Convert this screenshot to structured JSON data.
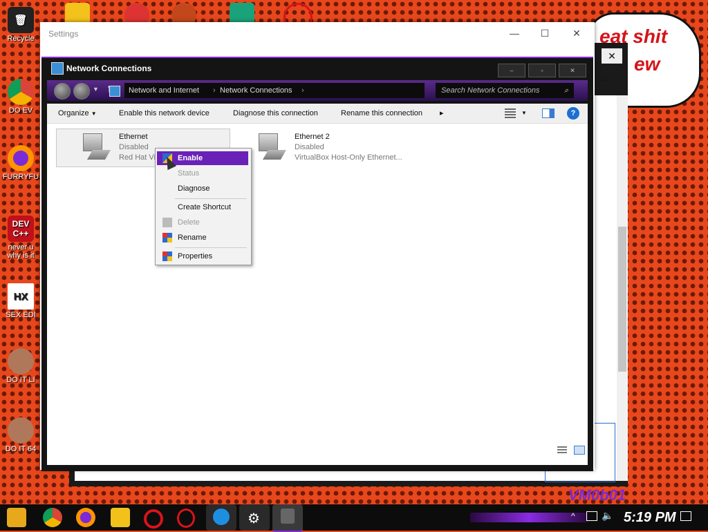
{
  "desktop": {
    "icons": [
      {
        "label": "Recycle"
      },
      {
        "label": "DO EV"
      },
      {
        "label": "FURRYFU"
      },
      {
        "label": "never u why is it"
      },
      {
        "label": "SEX EDI"
      },
      {
        "label": "DO IT LI"
      },
      {
        "label": "DO IT 64"
      }
    ],
    "bubble_text": [
      "eat shit",
      "ew"
    ],
    "watermark": "VM0b01"
  },
  "settings_window": {
    "title": "Settings",
    "minimize": "—",
    "maximize": "☐",
    "close": "✕"
  },
  "background_window": {
    "close": "✕",
    "more": "⋯"
  },
  "network_window": {
    "title": "Network Connections",
    "minimize": "–",
    "maximize": "▫",
    "close": "✕",
    "breadcrumb": [
      "Network and Internet",
      "Network Connections"
    ],
    "search_placeholder": "Search Network Connections",
    "toolbar": {
      "organize": "Organize",
      "enable": "Enable this network device",
      "diagnose": "Diagnose this connection",
      "rename": "Rename this connection"
    },
    "connections": [
      {
        "name": "Ethernet",
        "status": "Disabled",
        "adapter": "Red Hat Vir"
      },
      {
        "name": "Ethernet 2",
        "status": "Disabled",
        "adapter": "VirtualBox Host-Only Ethernet..."
      }
    ]
  },
  "context_menu": {
    "items": [
      {
        "label": "Enable",
        "state": "highlighted"
      },
      {
        "label": "Status",
        "state": "disabled"
      },
      {
        "label": "Diagnose",
        "state": "normal"
      },
      {
        "label": "Create Shortcut",
        "state": "normal"
      },
      {
        "label": "Delete",
        "state": "disabled"
      },
      {
        "label": "Rename",
        "state": "normal"
      },
      {
        "label": "Properties",
        "state": "normal"
      }
    ]
  },
  "taskbar": {
    "time": "5:19 PM",
    "pinned": [
      "start-icon",
      "chrome-icon",
      "firefox-icon",
      "file-explorer-icon",
      "opera-icon",
      "opera-gx-icon",
      "edge-icon",
      "settings-gear-icon",
      "network-app-icon"
    ]
  },
  "colors": {
    "accent_purple": "#6a21b8",
    "desktop_orange": "#e8471c"
  }
}
